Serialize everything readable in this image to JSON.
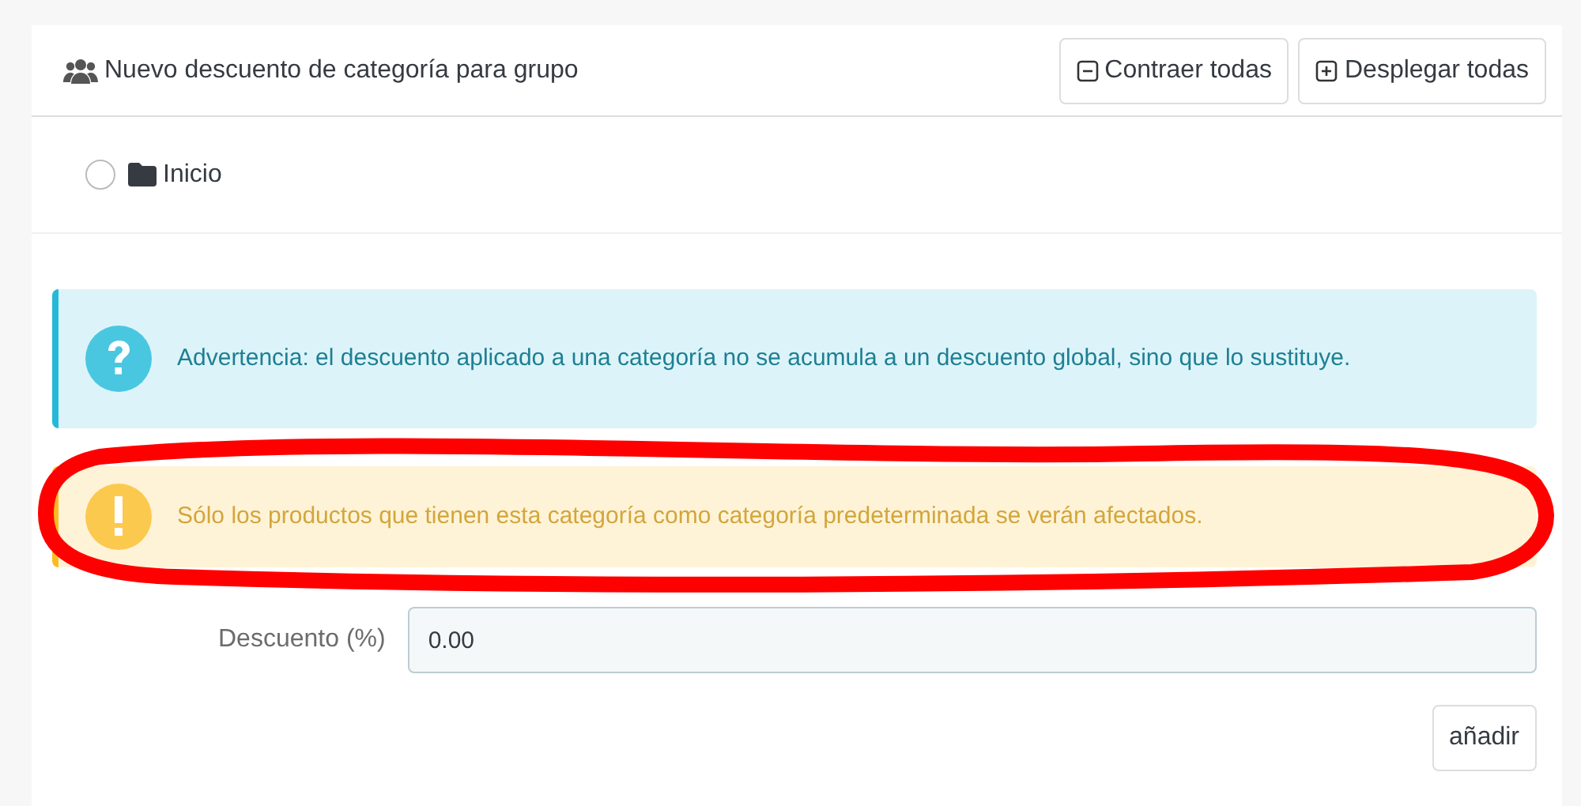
{
  "panel": {
    "title": "Nuevo descuento de categoría para grupo",
    "buttons": [
      {
        "kind": "collapse",
        "label": "Contraer todas"
      },
      {
        "kind": "expand",
        "label": "Desplegar todas"
      }
    ]
  },
  "tree": [
    {
      "label": "Inicio",
      "selected": false
    }
  ],
  "alerts": [
    {
      "kind": "info",
      "text": "Advertencia: el descuento aplicado a una categoría no se acumula a un descuento global, sino que lo sustituye."
    },
    {
      "kind": "warning",
      "text": "Sólo los productos que tienen esta categoría como categoría predeterminada se verán afectados.",
      "circled": true
    }
  ],
  "discount": {
    "label": "Descuento (%)",
    "value": "0.00"
  },
  "submit": "añadir"
}
